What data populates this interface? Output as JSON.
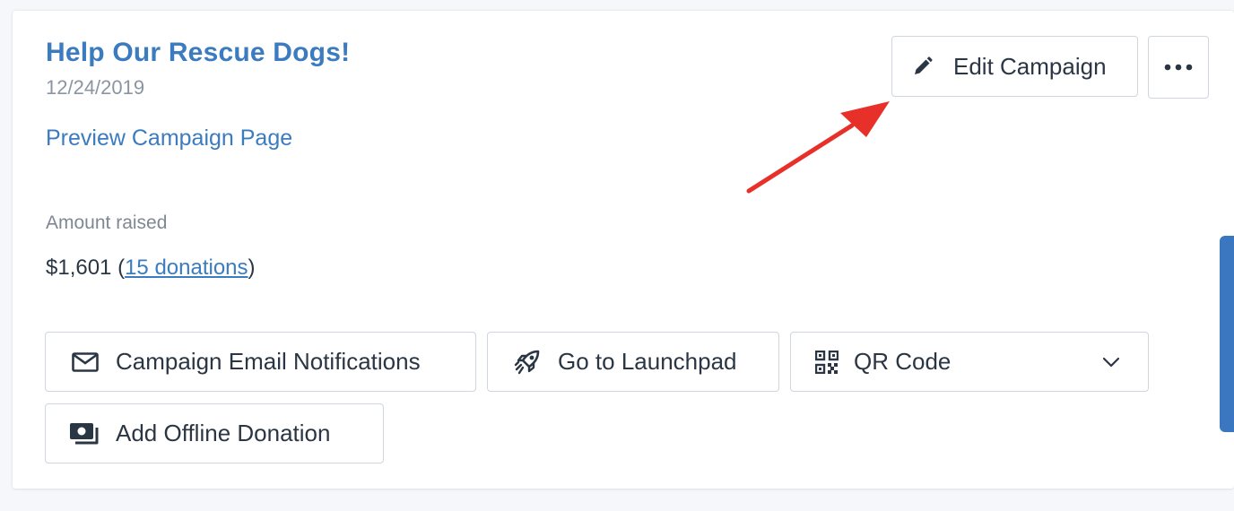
{
  "campaign": {
    "title": "Help Our Rescue Dogs!",
    "date": "12/24/2019",
    "preview_link": "Preview Campaign Page",
    "amount_label": "Amount raised",
    "amount_value": "$1,601",
    "donations_link": "15 donations"
  },
  "header_actions": {
    "edit_label": "Edit Campaign",
    "edit_icon": "pencil-icon",
    "more_icon": "ellipsis-icon"
  },
  "actions": {
    "email_label": "Campaign Email Notifications",
    "email_icon": "envelope-icon",
    "launchpad_label": "Go to Launchpad",
    "launchpad_icon": "rocket-icon",
    "qr_label": "QR Code",
    "qr_icon": "qr-code-icon",
    "qr_dropdown_icon": "chevron-down-icon",
    "offline_label": "Add Offline Donation",
    "offline_icon": "cash-icon"
  },
  "colors": {
    "accent": "#3b7bbf",
    "text": "#2b3644",
    "muted": "#8a95a1",
    "border": "#cfd6dd",
    "annotation_arrow": "#e8302a",
    "side_tab": "#3b76c1"
  }
}
